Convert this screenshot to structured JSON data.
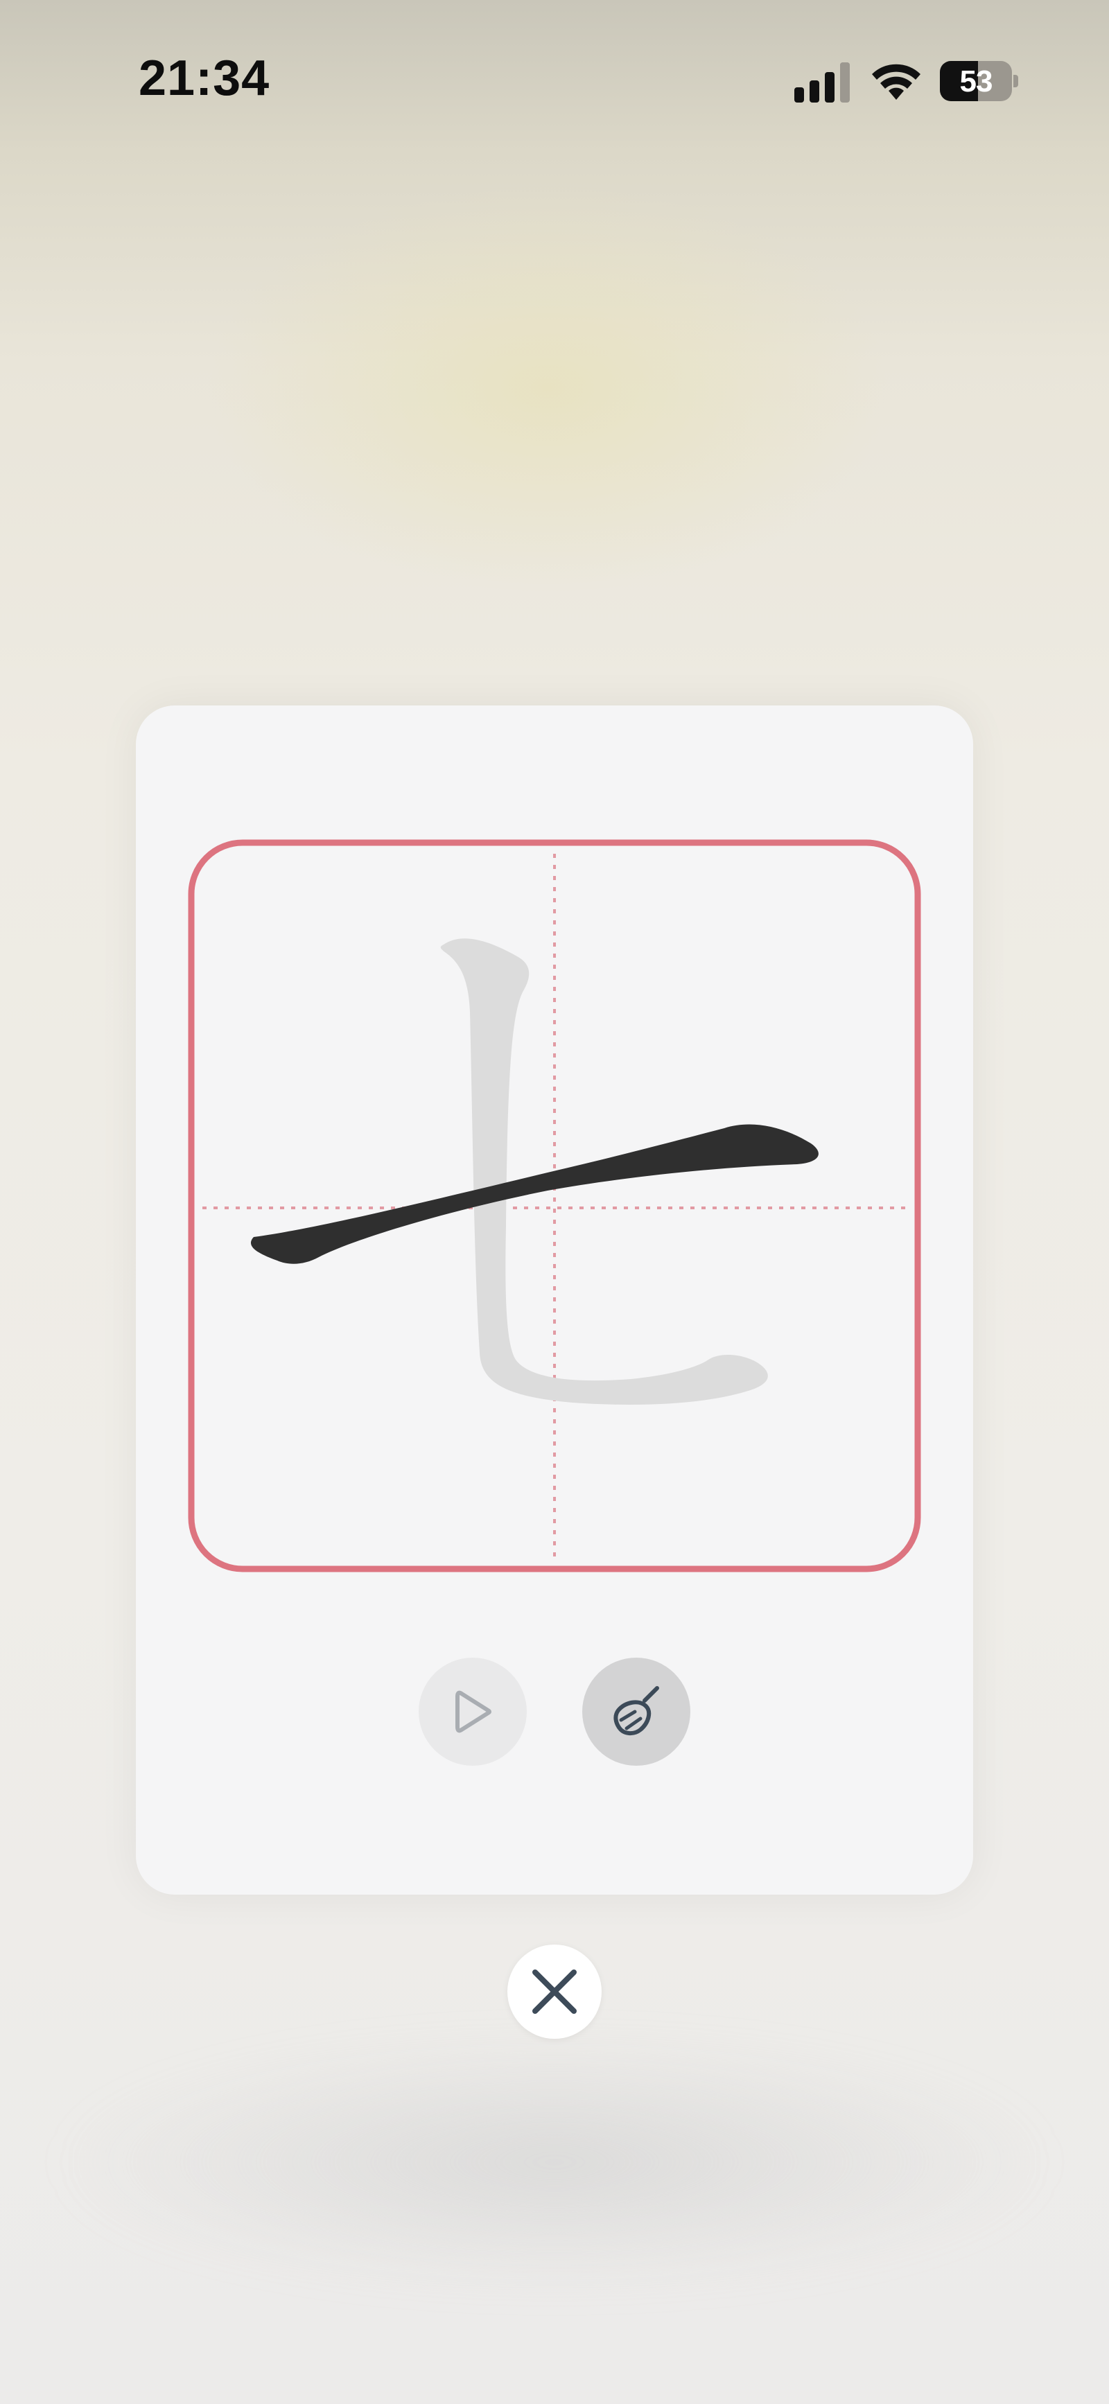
{
  "status_bar": {
    "time": "21:34",
    "battery_level": "53",
    "signal_icon": "cellular-signal-icon",
    "wifi_icon": "wifi-icon",
    "battery_icon": "battery-icon"
  },
  "practice_card": {
    "character": "七",
    "strokes_total": 2,
    "strokes_drawn": 1,
    "grid": {
      "border_color": "#dd7480",
      "guide_line_color": "#e29aa3",
      "guide_line_style": "dotted"
    },
    "colors": {
      "drawn_stroke": "#2f2f2f",
      "guide_character": "#dcdcdc"
    },
    "controls": {
      "play_icon": "play-icon",
      "clear_icon": "broom-icon"
    }
  },
  "close_icon": "close-icon"
}
